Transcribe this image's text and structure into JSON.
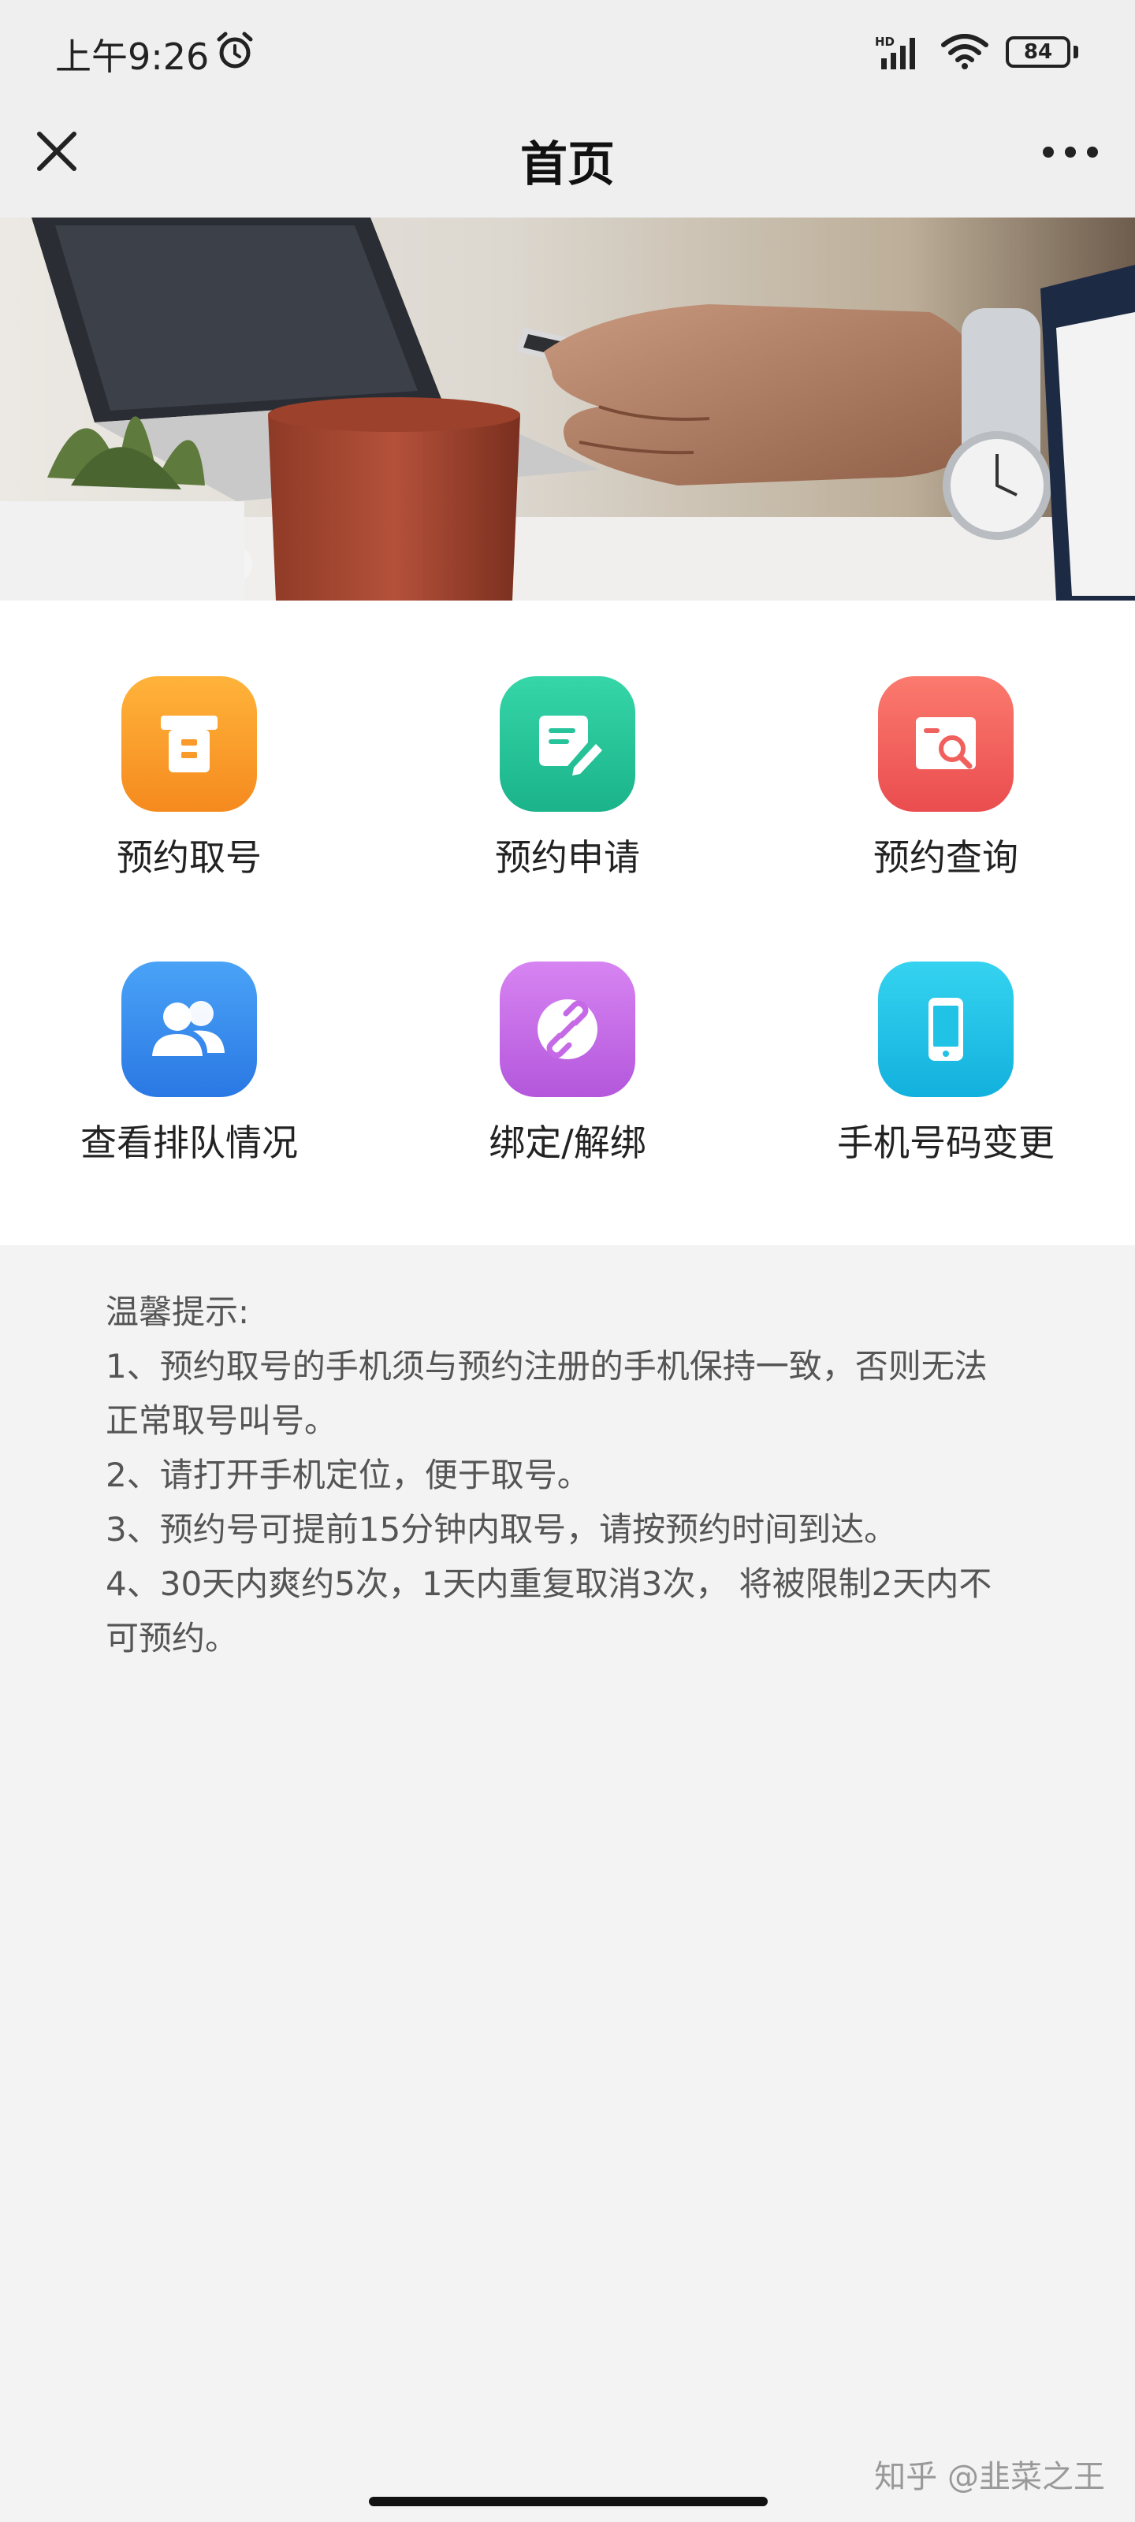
{
  "status_bar": {
    "time": "上午9:26",
    "network": "HD",
    "battery": "84"
  },
  "navbar": {
    "title": "首页"
  },
  "menu": [
    {
      "label": "预约取号",
      "icon": "ticket-icon",
      "color": "#f99a2a"
    },
    {
      "label": "预约申请",
      "icon": "edit-document-icon",
      "color": "#27c49b"
    },
    {
      "label": "预约查询",
      "icon": "search-document-icon",
      "color": "#f0605c"
    },
    {
      "label": "查看排队情况",
      "icon": "users-icon",
      "color": "#3d8ef0"
    },
    {
      "label": "绑定/解绑",
      "icon": "link-icon",
      "color": "#c569e6"
    },
    {
      "label": "手机号码变更",
      "icon": "phone-icon",
      "color": "#20c2e6"
    }
  ],
  "notice": {
    "title": "温馨提示:",
    "lines": [
      "1、预约取号的手机须与预约注册的手机保持一致，否则无法",
      "正常取号叫号。",
      "2、请打开手机定位，便于取号。",
      "3、预约号可提前15分钟内取号，请按预约时间到达。",
      "4、30天内爽约5次，1天内重复取消3次， 将被限制2天内不",
      "可预约。"
    ]
  },
  "watermark": "知乎 @韭菜之王"
}
